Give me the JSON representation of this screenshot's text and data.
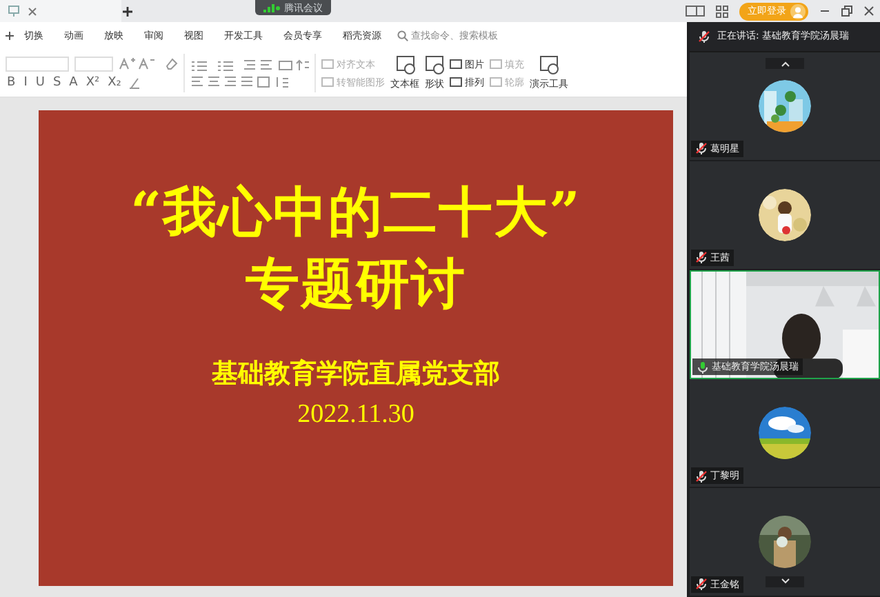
{
  "title_bar": {
    "meeting_badge": "腾讯会议",
    "login_button": "立即登录"
  },
  "menu_tabs": [
    "切换",
    "动画",
    "放映",
    "审阅",
    "视图",
    "开发工具",
    "会员专享",
    "稻壳资源"
  ],
  "search": {
    "placeholder": "查找命令、搜索模板"
  },
  "format_glyphs": [
    "B",
    "I",
    "U",
    "S",
    "A",
    "X²",
    "X₂"
  ],
  "tools": [
    {
      "kind": "small",
      "label": "对齐文本",
      "disabled": true
    },
    {
      "kind": "small",
      "label": "转智能图形",
      "disabled": true
    },
    {
      "kind": "big",
      "label": "文本框",
      "disabled": false
    },
    {
      "kind": "big",
      "label": "形状",
      "disabled": false
    },
    {
      "kind": "small",
      "label": "图片",
      "disabled": false
    },
    {
      "kind": "small",
      "label": "排列",
      "disabled": false
    },
    {
      "kind": "small",
      "label": "填充",
      "disabled": true
    },
    {
      "kind": "small",
      "label": "轮廓",
      "disabled": true
    },
    {
      "kind": "big",
      "label": "演示工具",
      "disabled": false
    }
  ],
  "slide": {
    "title_lines": [
      "“我心中的二十大”",
      "专题研讨"
    ],
    "organization": "基础教育学院直属党支部",
    "date": "2022.11.30"
  },
  "meeting": {
    "speaking_label": "正在讲话: 基础教育学院汤晨瑞",
    "participants": [
      {
        "name": "葛明星",
        "kind": "avatar",
        "muted": true,
        "speaking": false
      },
      {
        "name": "王茜",
        "kind": "avatar",
        "muted": true,
        "speaking": false
      },
      {
        "name": "基础教育学院汤晨瑞",
        "kind": "video",
        "muted": false,
        "speaking": true
      },
      {
        "name": "丁黎明",
        "kind": "avatar",
        "muted": true,
        "speaking": false
      },
      {
        "name": "王金铭",
        "kind": "avatar",
        "muted": true,
        "speaking": false
      }
    ]
  }
}
